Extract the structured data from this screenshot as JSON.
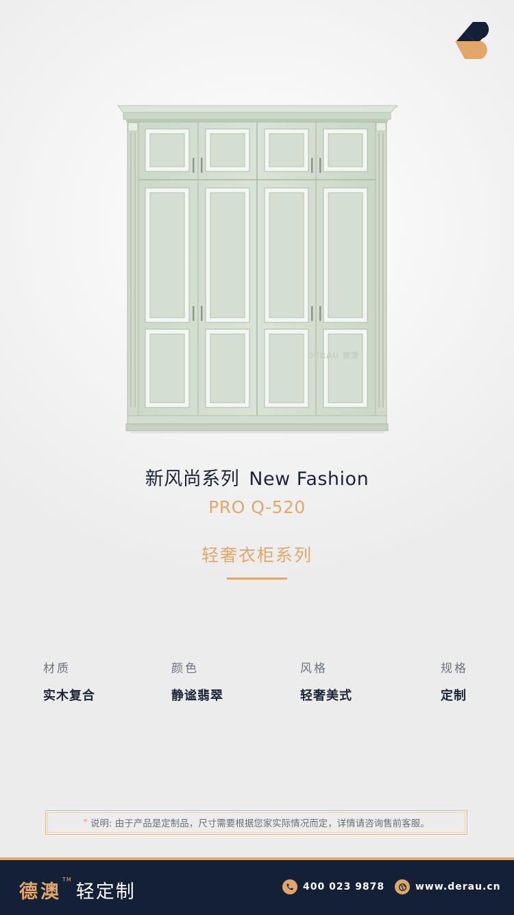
{
  "product": {
    "title_cn": "新风尚系列",
    "title_en": "New Fashion",
    "model": "PRO Q-520",
    "series": "轻奢衣柜系列",
    "watermark": "DERAU 德澳"
  },
  "specs": [
    {
      "label": "材质",
      "value": "实木复合"
    },
    {
      "label": "颜色",
      "value": "静谧翡翠"
    },
    {
      "label": "风格",
      "value": "轻奢美式"
    },
    {
      "label": "规格",
      "value": "定制"
    }
  ],
  "note": {
    "star": "*",
    "text": "说明: 由于产品是定制品，尺寸需要根据您家实际情况而定，详情请咨询售前客服。"
  },
  "footer": {
    "brand": "德澳",
    "tm": "TM",
    "brand_sub": "轻定制",
    "phone": "400 023 9878",
    "website": "www.derau.cn"
  },
  "icons": {
    "logo": "derau-logo-icon",
    "phone": "phone-icon",
    "globe": "globe-icon"
  },
  "colors": {
    "accent": "#e2a66a",
    "navy": "#142035",
    "wardrobe": "#d5e0d2"
  }
}
